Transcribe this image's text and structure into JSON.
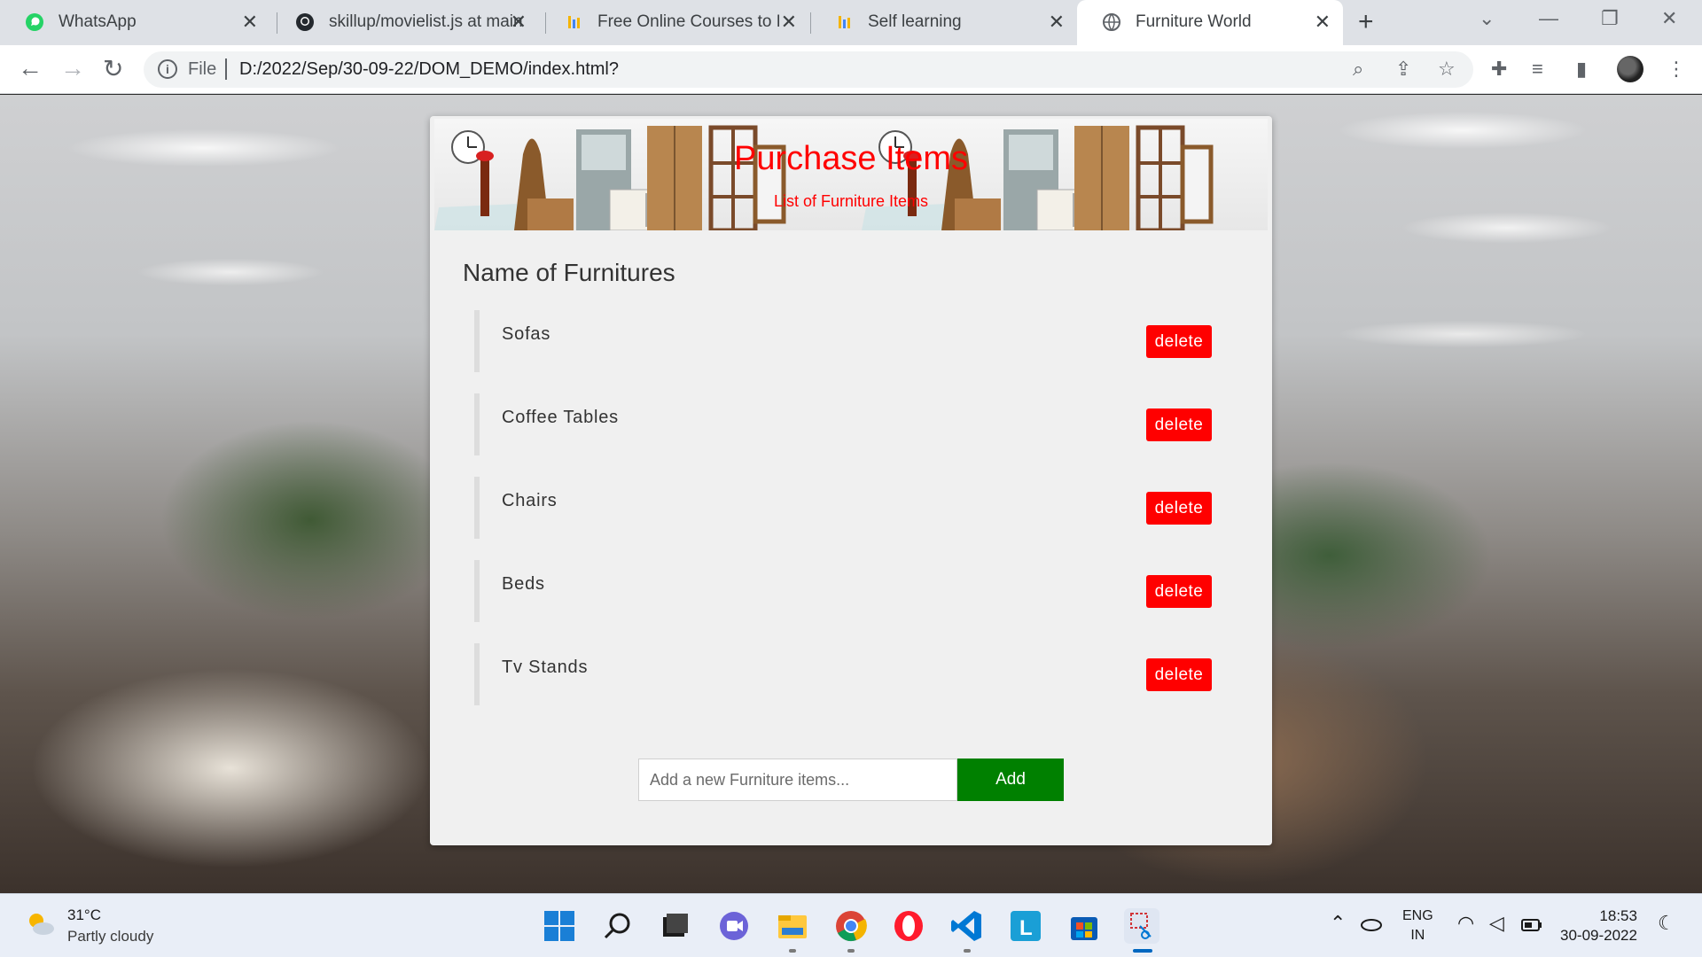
{
  "browser": {
    "tabs": [
      {
        "title": "WhatsApp",
        "icon": "whatsapp-icon",
        "active": false
      },
      {
        "title": "skillup/movielist.js at main",
        "icon": "github-icon",
        "active": false
      },
      {
        "title": "Free Online Courses to Pro",
        "icon": "chart-icon",
        "active": false
      },
      {
        "title": "Self learning",
        "icon": "chart-icon",
        "active": false
      },
      {
        "title": "Furniture World",
        "icon": "globe-icon",
        "active": true
      }
    ],
    "address": {
      "scheme": "File",
      "url": "D:/2022/Sep/30-09-22/DOM_DEMO/index.html?"
    }
  },
  "page": {
    "banner": {
      "title": "Purchase Items",
      "subtitle": "List of Furniture Items"
    },
    "section_title": "Name of Furnitures",
    "items": [
      {
        "name": "Sofas",
        "delete_label": "delete"
      },
      {
        "name": "Coffee Tables",
        "delete_label": "delete"
      },
      {
        "name": "Chairs",
        "delete_label": "delete"
      },
      {
        "name": "Beds",
        "delete_label": "delete"
      },
      {
        "name": "Tv Stands",
        "delete_label": "delete"
      }
    ],
    "form": {
      "placeholder": "Add a new Furniture items...",
      "add_label": "Add"
    },
    "colors": {
      "delete": "#ff0000",
      "add": "#008000",
      "banner_text": "#ff0000"
    }
  },
  "taskbar": {
    "weather": {
      "temp": "31°C",
      "desc": "Partly cloudy"
    },
    "lang": {
      "line1": "ENG",
      "line2": "IN"
    },
    "clock": {
      "time": "18:53",
      "date": "30-09-2022"
    }
  }
}
